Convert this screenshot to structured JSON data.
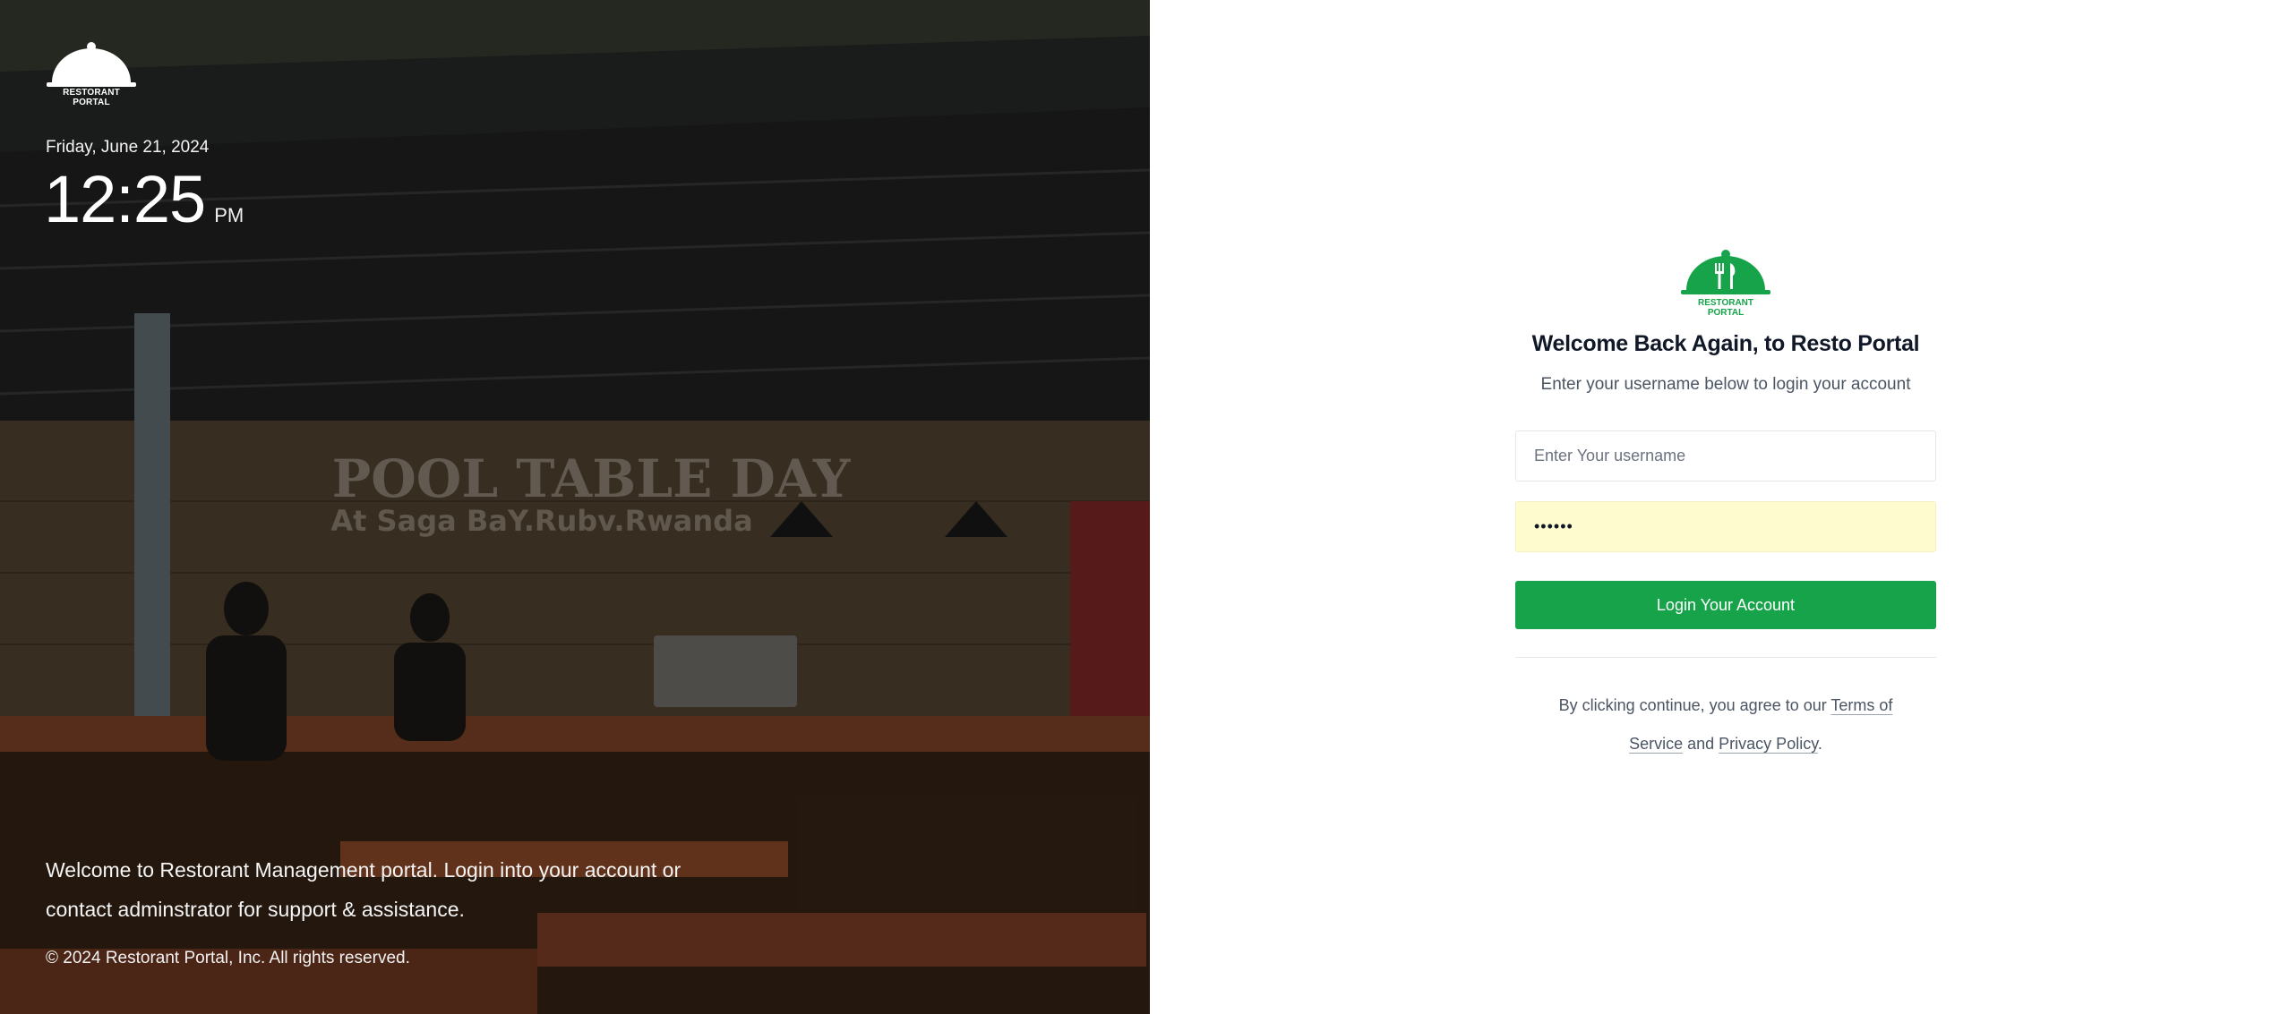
{
  "left_panel": {
    "brand_caption": "RESTORANT PORTAL",
    "date": "Friday, June 21, 2024",
    "time": "12:25",
    "ampm": "PM",
    "welcome_message": "Welcome to Restorant Management portal. Login into your account or contact adminstrator for support & assistance.",
    "copyright": "© 2024 Restorant Portal, Inc. All rights reserved.",
    "background_sign_line1": "POOL TABLE DAY",
    "background_sign_line2": "At Saga BaY.Rubv.Rwanda"
  },
  "login": {
    "logo_caption": "RESTORANT PORTAL",
    "title": "Welcome Back Again, to Resto Portal",
    "subtitle": "Enter your username below to login your account",
    "username_placeholder": "Enter Your username",
    "username_value": "",
    "password_value": "••••••",
    "button_label": "Login Your Account",
    "terms_prefix": "By clicking continue, you agree to our ",
    "terms_link": "Terms of Service",
    "terms_and": " and ",
    "privacy_link": "Privacy Policy",
    "terms_suffix": "."
  },
  "colors": {
    "accent": "#16a34a",
    "autofill_bg": "#fefccf",
    "text_dark": "#111827",
    "text_muted": "#4b5563"
  },
  "icons": {
    "brand_logo": "cloche-icon",
    "login_logo": "cloche-fork-knife-icon"
  }
}
